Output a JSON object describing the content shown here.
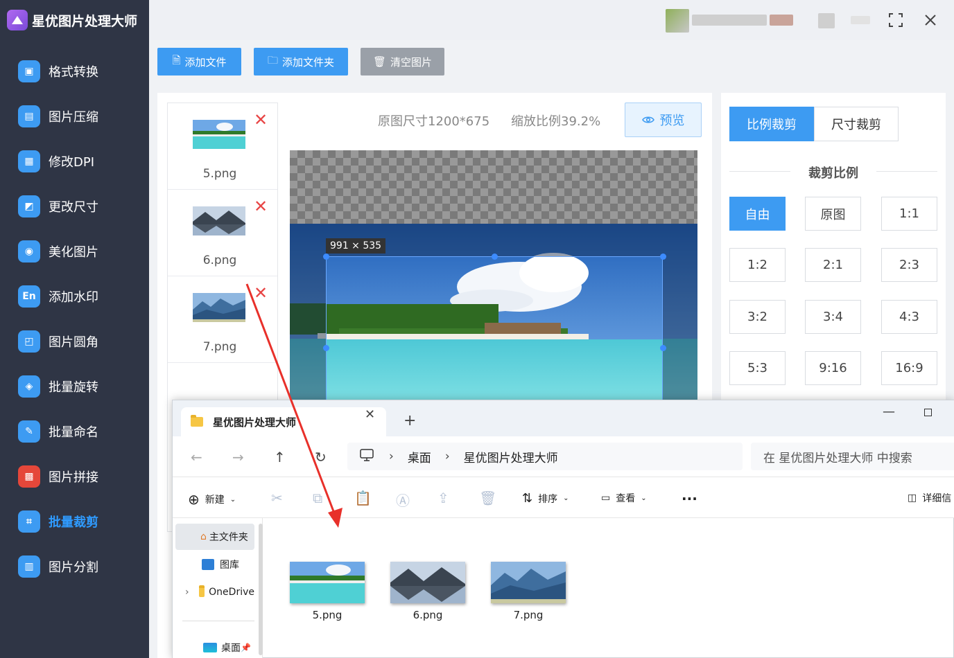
{
  "app": {
    "title": "星优图片处理大师"
  },
  "sidebar": {
    "items": [
      {
        "label": "格式转换",
        "icon": "image-convert-icon",
        "color": "#3d9bf2"
      },
      {
        "label": "图片压缩",
        "icon": "compress-icon",
        "color": "#3d9bf2"
      },
      {
        "label": "修改DPI",
        "icon": "dpi-icon",
        "color": "#3d9bf2"
      },
      {
        "label": "更改尺寸",
        "icon": "resize-icon",
        "color": "#3d9bf2"
      },
      {
        "label": "美化图片",
        "icon": "beautify-icon",
        "color": "#3d9bf2"
      },
      {
        "label": "添加水印",
        "icon": "watermark-icon",
        "color": "#3d9bf2"
      },
      {
        "label": "图片圆角",
        "icon": "round-corner-icon",
        "color": "#3d9bf2"
      },
      {
        "label": "批量旋转",
        "icon": "rotate-icon",
        "color": "#3d9bf2"
      },
      {
        "label": "批量命名",
        "icon": "rename-icon",
        "color": "#3d9bf2"
      },
      {
        "label": "图片拼接",
        "icon": "puzzle-icon",
        "color": "#e5473a"
      },
      {
        "label": "批量裁剪",
        "icon": "crop-icon",
        "color": "#3d9bf2",
        "active": true
      },
      {
        "label": "图片分割",
        "icon": "split-icon",
        "color": "#3d9bf2"
      }
    ]
  },
  "toolbar": {
    "add_file": "添加文件",
    "add_folder": "添加文件夹",
    "clear": "清空图片"
  },
  "files": [
    "5.png",
    "6.png",
    "7.png"
  ],
  "preview": {
    "original_size": "原图尺寸1200*675",
    "zoom": "缩放比例39.2%",
    "preview_label": "预览",
    "crop_size": "991 × 535"
  },
  "crop": {
    "tab_ratio": "比例裁剪",
    "tab_size": "尺寸裁剪",
    "section_title": "裁剪比例",
    "ratios": [
      "自由",
      "原图",
      "1:1",
      "1:2",
      "2:1",
      "2:3",
      "3:2",
      "3:4",
      "4:3",
      "5:3",
      "9:16",
      "16:9"
    ],
    "selected": "自由"
  },
  "explorer": {
    "tab_title": "星优图片处理大师",
    "breadcrumb": [
      "桌面",
      "星优图片处理大师"
    ],
    "search_placeholder": "在 星优图片处理大师 中搜索",
    "tools": {
      "new": "新建",
      "sort": "排序",
      "view": "查看",
      "more": "...",
      "details": "详细信"
    },
    "side": [
      "主文件夹",
      "图库",
      "OneDrive",
      "桌面"
    ],
    "files": [
      "5.png",
      "6.png",
      "7.png"
    ]
  },
  "colors": {
    "accent": "#3d9bf2",
    "sidebar": "#2f3545",
    "delete": "#e84545",
    "arrow": "#e8302a"
  }
}
